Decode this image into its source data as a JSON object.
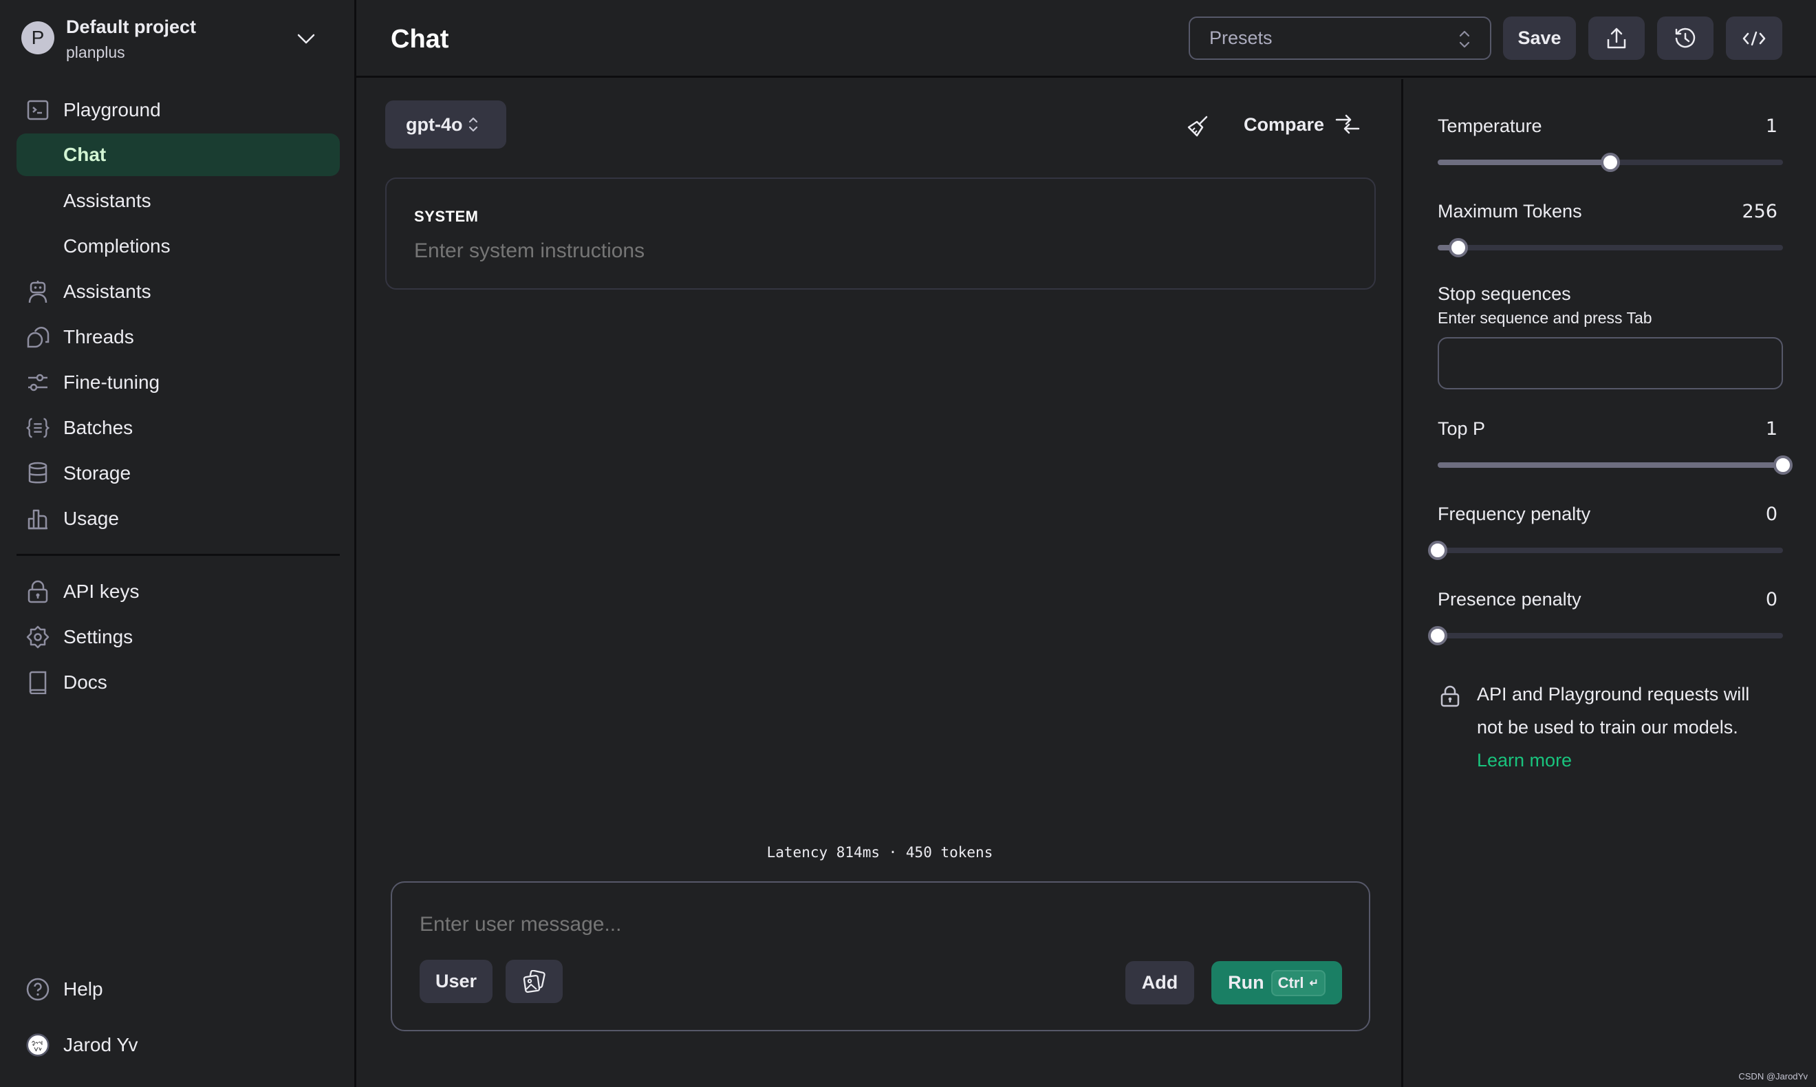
{
  "project": {
    "avatar_letter": "P",
    "name": "Default project",
    "org": "planplus"
  },
  "sidebar": {
    "items": [
      {
        "label": "Playground",
        "icon": "terminal-icon"
      },
      {
        "label": "Chat",
        "icon": "",
        "active": true
      },
      {
        "label": "Assistants",
        "icon": ""
      },
      {
        "label": "Completions",
        "icon": ""
      },
      {
        "label": "Assistants",
        "icon": "robot-icon"
      },
      {
        "label": "Threads",
        "icon": "chat-bubbles-icon"
      },
      {
        "label": "Fine-tuning",
        "icon": "sliders-icon"
      },
      {
        "label": "Batches",
        "icon": "braces-list-icon"
      },
      {
        "label": "Storage",
        "icon": "database-icon"
      },
      {
        "label": "Usage",
        "icon": "bar-chart-icon"
      }
    ],
    "bottom_items": [
      {
        "label": "API keys",
        "icon": "lock-icon"
      },
      {
        "label": "Settings",
        "icon": "gear-icon"
      },
      {
        "label": "Docs",
        "icon": "book-icon"
      }
    ],
    "help_label": "Help",
    "user_name": "Jarod Yv"
  },
  "header": {
    "title": "Chat",
    "presets_placeholder": "Presets",
    "save_label": "Save"
  },
  "main": {
    "model": "gpt-4o",
    "compare_label": "Compare",
    "system_label": "SYSTEM",
    "system_placeholder": "Enter system instructions",
    "latency": "Latency 814ms · 450 tokens",
    "message_placeholder": "Enter user message...",
    "role_label": "User",
    "add_label": "Add",
    "run_label": "Run",
    "run_shortcut": "Ctrl",
    "run_shortcut_symbol": "↵"
  },
  "params": {
    "temperature": {
      "label": "Temperature",
      "value": "1",
      "fraction": 0.5
    },
    "max_tokens": {
      "label": "Maximum Tokens",
      "value": "256",
      "fraction": 0.06
    },
    "stop_sequences": {
      "label": "Stop sequences",
      "hint": "Enter sequence and press Tab",
      "value": ""
    },
    "top_p": {
      "label": "Top P",
      "value": "1",
      "fraction": 1.0
    },
    "frequency_penalty": {
      "label": "Frequency penalty",
      "value": "0",
      "fraction": 0.0
    },
    "presence_penalty": {
      "label": "Presence penalty",
      "value": "0",
      "fraction": 0.0
    }
  },
  "notice": {
    "text": "API and Playground requests will not be used to train our models.",
    "link": "Learn more"
  },
  "colors": {
    "accent_green": "#1a7f64",
    "link_green": "#19c37d",
    "active_nav_bg": "#1a3d31"
  },
  "watermark": "CSDN @JarodYv"
}
